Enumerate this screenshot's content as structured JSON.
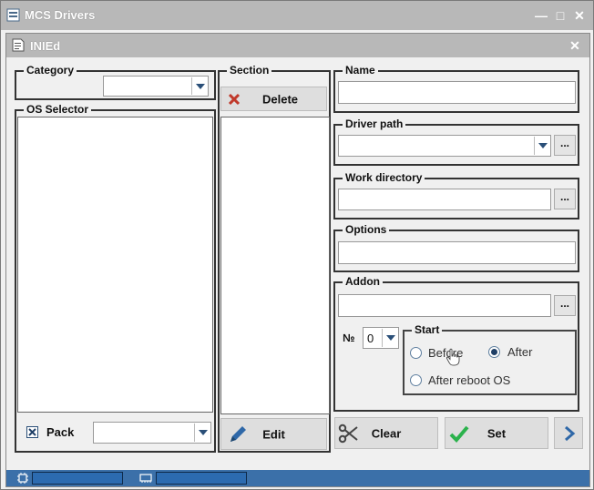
{
  "window": {
    "title": "MCS Drivers",
    "controls": {
      "minimize": "—",
      "maximize": "□",
      "close": "✕"
    }
  },
  "dialog": {
    "title": "INIEd",
    "close": "✕"
  },
  "category": {
    "label": "Category",
    "value": ""
  },
  "os_selector": {
    "label": "OS Selector",
    "items": []
  },
  "section": {
    "label": "Section",
    "delete_label": "Delete",
    "items": [],
    "edit_label": "Edit"
  },
  "pack": {
    "label": "Pack",
    "checked": true,
    "value": ""
  },
  "name": {
    "label": "Name",
    "value": ""
  },
  "driver_path": {
    "label": "Driver path",
    "value": "",
    "browse": "..."
  },
  "work_directory": {
    "label": "Work directory",
    "value": "",
    "browse": "..."
  },
  "options": {
    "label": "Options",
    "value": ""
  },
  "addon": {
    "label": "Addon",
    "value": "",
    "browse": "..."
  },
  "number": {
    "label": "№",
    "value": "0"
  },
  "start": {
    "label": "Start",
    "options": [
      {
        "label": "Before",
        "selected": false
      },
      {
        "label": "After",
        "selected": true
      },
      {
        "label": "After reboot OS",
        "selected": false
      }
    ]
  },
  "buttons": {
    "clear": "Clear",
    "set": "Set",
    "next_icon": "chevron-right-icon"
  },
  "colors": {
    "delete_icon": "#c0392b",
    "set_icon": "#2bb24c",
    "status_bar": "#3b70a9",
    "title_bar": "#b8b8b8"
  }
}
